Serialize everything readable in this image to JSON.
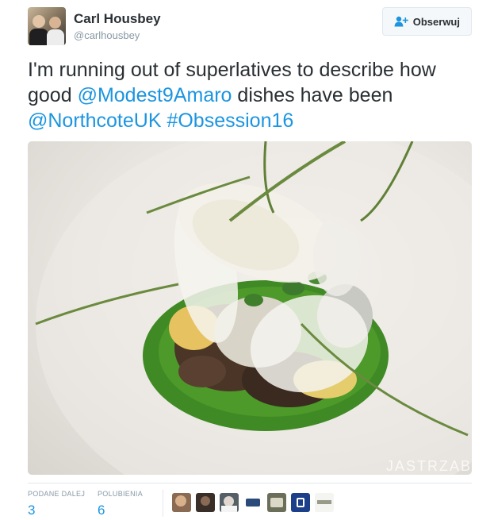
{
  "user": {
    "name": "Carl Housbey",
    "handle": "@carlhousbey"
  },
  "follow_button": {
    "label": "Obserwuj",
    "icon": "add-user-icon"
  },
  "tweet": {
    "text_1": "I'm running out of superlatives to describe how good ",
    "mention_1": "@Modest9Amaro",
    "text_2": " dishes have been ",
    "mention_2": "@NorthcoteUK",
    "text_3": " ",
    "hashtag": "#Obsession16"
  },
  "media": {
    "watermark": "JASTRZAB"
  },
  "stats": {
    "retweets_label": "PODANE DALEJ",
    "retweets_count": "3",
    "likes_label": "POLUBIENIA",
    "likes_count": "6"
  },
  "likers": [
    {
      "name": "liker-1"
    },
    {
      "name": "liker-2"
    },
    {
      "name": "liker-3"
    },
    {
      "name": "liker-4"
    },
    {
      "name": "liker-5"
    },
    {
      "name": "liker-6"
    },
    {
      "name": "liker-7"
    }
  ],
  "colors": {
    "link": "#1b95e0",
    "text": "#292f33",
    "muted": "#8899a6"
  }
}
